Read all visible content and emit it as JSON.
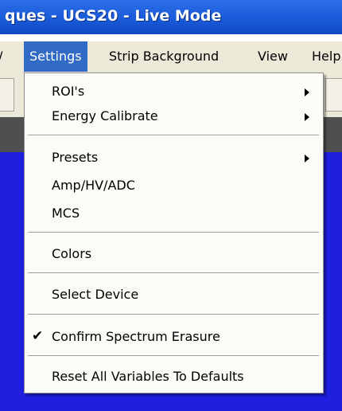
{
  "window": {
    "title": "ques - UCS20 - Live Mode"
  },
  "menubar": {
    "file_partial": "/",
    "settings": "Settings",
    "strip_background": "Strip Background",
    "view": "View",
    "help_partial": "Help"
  },
  "settings_menu": {
    "items": [
      {
        "label": "ROI's",
        "submenu": true
      },
      {
        "label": "Energy Calibrate",
        "submenu": true
      },
      {
        "label": "Presets",
        "submenu": true
      },
      {
        "label": "Amp/HV/ADC"
      },
      {
        "label": "MCS"
      },
      {
        "label": "Colors"
      },
      {
        "label": "Select Device"
      },
      {
        "label": "Confirm Spectrum Erasure",
        "checked": true,
        "check_glyph": "✔"
      },
      {
        "label": "Reset All Variables To Defaults"
      }
    ]
  },
  "colors": {
    "title_bar": "#1a5bd9",
    "menu_highlight": "#316ac5",
    "workspace": "#1f1fe0",
    "chrome": "#ece9d8"
  }
}
